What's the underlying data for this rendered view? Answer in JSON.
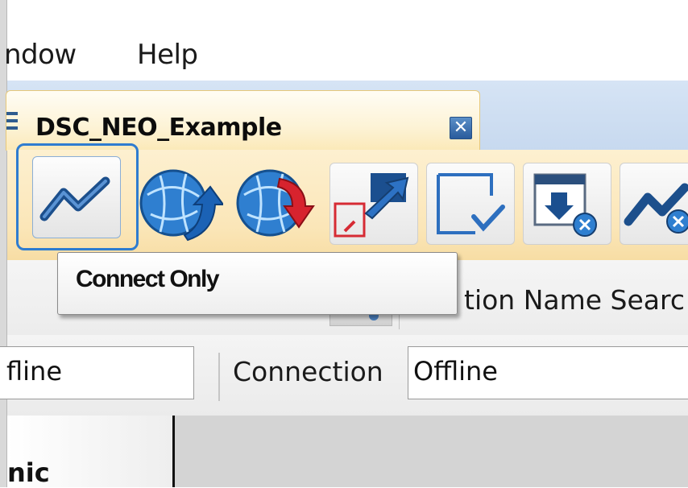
{
  "menu": {
    "window_label": "ndow",
    "help_label": "Help"
  },
  "tab": {
    "title": "DSC_NEO_Example",
    "close_glyph": "✕"
  },
  "toolbar": {
    "buttons": [
      {
        "name": "connect-only",
        "icon": "lightning-connect-icon"
      },
      {
        "name": "upload",
        "icon": "globe-upload-icon"
      },
      {
        "name": "download",
        "icon": "globe-download-icon"
      },
      {
        "name": "transfer",
        "icon": "transfer-arrows-icon"
      },
      {
        "name": "verify",
        "icon": "verify-check-icon"
      },
      {
        "name": "download-cancel",
        "icon": "download-cancel-icon"
      },
      {
        "name": "disconnect",
        "icon": "disconnect-icon"
      }
    ]
  },
  "tooltip": {
    "text": "Connect Only"
  },
  "search": {
    "label": "tion Name Searc"
  },
  "status": {
    "left_value": "fline",
    "connection_label": "Connection",
    "connection_value": "Offline"
  },
  "pane": {
    "label": "nic"
  },
  "colors": {
    "highlight_border": "#2e7cd0",
    "toolbar_bg": "#fbe6b8",
    "tab_bg": "#fdf3d6"
  }
}
